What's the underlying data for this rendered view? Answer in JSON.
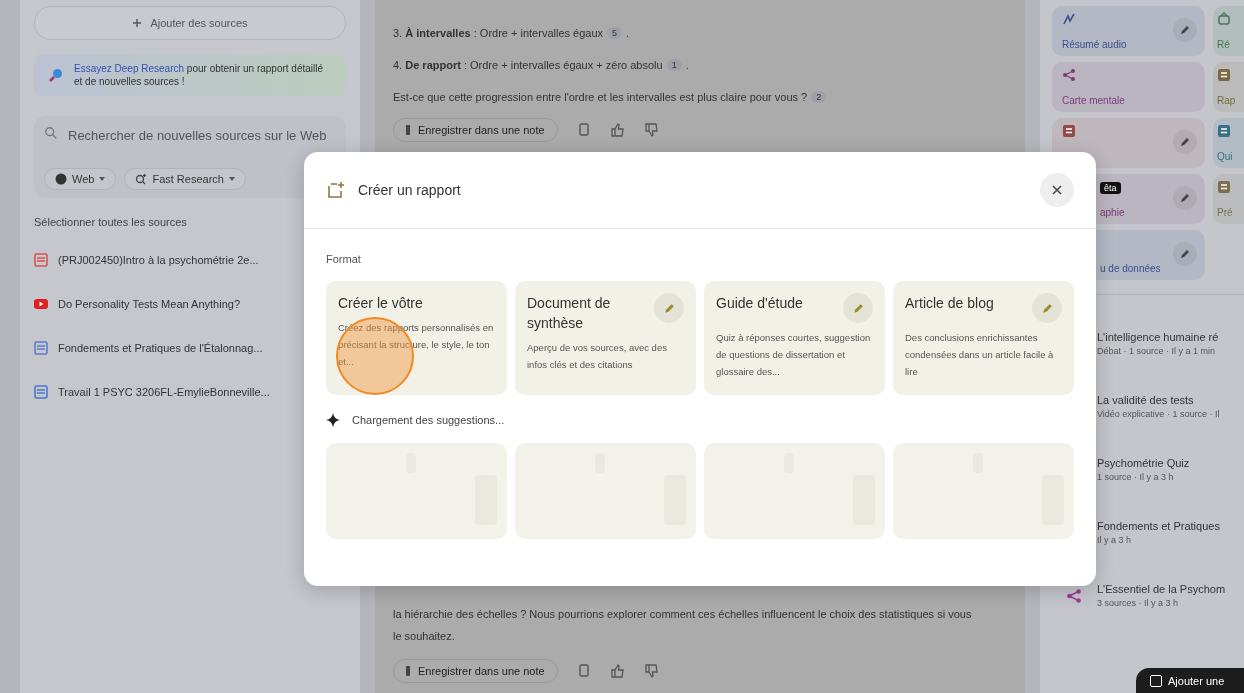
{
  "sources_panel": {
    "add_button": "Ajouter des sources",
    "tip": {
      "link": "Essayez Deep Research",
      "text": " pour obtenir un rapport détaillé et de nouvelles sources !"
    },
    "search": {
      "placeholder": "Rechercher de nouvelles sources sur le Web",
      "chips": [
        {
          "kind": "web",
          "label": "Web"
        },
        {
          "kind": "research",
          "label": "Fast Research"
        }
      ]
    },
    "select_all": "Sélectionner toutes les sources",
    "sources": [
      {
        "kind": "pdf",
        "title": "(PRJ002450)Intro à la psychométrie 2e..."
      },
      {
        "kind": "youtube",
        "title": "Do Personality Tests Mean Anything?"
      },
      {
        "kind": "slides",
        "title": "Fondements et Pratiques de l'Étalonnag..."
      },
      {
        "kind": "doc",
        "title": "Travail 1 PSYC 3206FL-EmylieBonneville..."
      }
    ]
  },
  "chat": {
    "lines": [
      {
        "text": "3. **À intervalles** : Ordre + intervalles égaux",
        "citation": "5",
        "end": "."
      },
      {
        "text": "4. **De rapport** : Ordre + intervalles égaux + zéro absolu",
        "citation": "1",
        "end": "."
      },
      {
        "text": "Est-ce que cette progression entre l'ordre et les intervalles est plus claire pour vous ?",
        "citation": "2"
      }
    ],
    "save_button": "Enregistrer dans une note",
    "last_paragraph": "la hiérarchie des échelles ? Nous pourrions explorer comment ces échelles influencent le choix des statistiques si vous le souhaitez.",
    "save_button_2": "Enregistrer dans une note"
  },
  "studio": {
    "tiles": [
      {
        "kind": "audio",
        "label": "Résumé audio",
        "color": "#3a4f8f",
        "edit": true,
        "covered": false
      },
      {
        "kind": "video",
        "label": "Ré",
        "color": "#3f7a50",
        "covered": false
      },
      {
        "kind": "mindmap",
        "label": "Carte mentale",
        "color": "#7f3a7d",
        "edit": false,
        "covered": false
      },
      {
        "kind": "report",
        "label": "Rap",
        "color": "#7a6a45",
        "covered": false
      },
      {
        "kind": "flashcards",
        "color": "#934a48",
        "edit": true,
        "covered": false
      },
      {
        "kind": "quiz",
        "label": "Qui",
        "color": "#3a6f8a",
        "covered": false
      },
      {
        "label": "aphie",
        "color": "#7a3a76",
        "edit": true,
        "covered": true,
        "badge": "êta"
      },
      {
        "kind": "slides",
        "label": "Pré",
        "color": "#7a7050",
        "covered": false
      },
      {
        "label": "u de données",
        "color": "#3a4f8f",
        "edit": true,
        "covered": true
      }
    ],
    "notes": [
      {
        "title": "L'intelligence humaine ré",
        "meta": "Débat · 1 source · Il y a 1 min"
      },
      {
        "title": "La validité des tests",
        "meta": "Vidéo explicative · 1 source · Il"
      },
      {
        "title": "Psychométrie Quiz",
        "meta": "1 source · Il y a 3 h"
      },
      {
        "title": "Fondements et Pratiques",
        "meta": "Il y a 3 h"
      },
      {
        "kind": "mindmap",
        "title": "L'Essentiel de la Psychom",
        "meta": "3 sources · Il y a 3 h"
      }
    ],
    "add_note_button": "Ajouter une"
  },
  "dialog": {
    "title": "Créer un rapport",
    "format_label": "Format",
    "formats": [
      {
        "title": "Créer le vôtre",
        "description": "Créez des rapports personnalisés en précisant la structure, le style, le ton et...",
        "edit": false,
        "clicked": true
      },
      {
        "title": "Document de synthèse",
        "description": "Aperçu de vos sources, avec des infos clés et des citations",
        "edit": true,
        "clicked": false
      },
      {
        "title": "Guide d'étude",
        "description": "Quiz à réponses courtes, suggestion de questions de dissertation et glossaire des...",
        "edit": true,
        "clicked": false
      },
      {
        "title": "Article de blog",
        "description": "Des conclusions enrichissantes condensées dans un article facile à lire",
        "edit": true,
        "clicked": false
      }
    ],
    "loading_label": "Chargement des suggestions...",
    "placeholders": [
      {
        "kind": "skeleton"
      },
      {
        "kind": "skeleton"
      },
      {
        "kind": "skeleton"
      },
      {
        "kind": "skeleton"
      }
    ]
  }
}
